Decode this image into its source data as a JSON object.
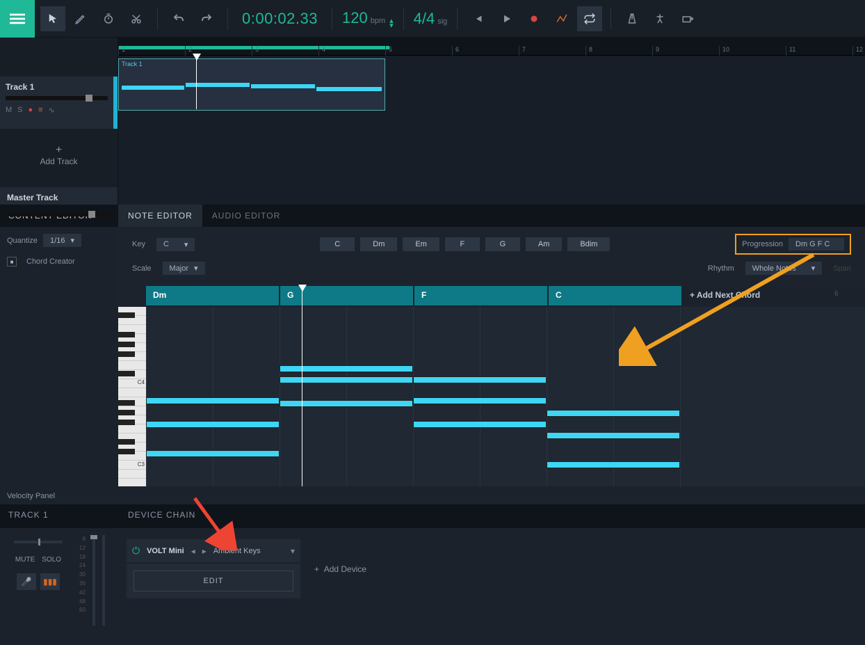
{
  "toolbar": {
    "timecode": "0:00:02.33",
    "tempo": "120",
    "tempo_unit": "bpm",
    "timesig": "4/4",
    "timesig_unit": "sig"
  },
  "track": {
    "name": "Track 1",
    "mute": "M",
    "solo": "S",
    "add": "Add Track",
    "master": "Master Track"
  },
  "content_editor": "CONTENT EDITOR",
  "editor_tabs": {
    "note": "NOTE EDITOR",
    "audio": "AUDIO EDITOR"
  },
  "quantize": {
    "label": "Quantize",
    "value": "1/16"
  },
  "chord_creator": "Chord Creator",
  "key": {
    "label": "Key",
    "value": "C"
  },
  "scale": {
    "label": "Scale",
    "value": "Major"
  },
  "chords": [
    "C",
    "Dm",
    "Em",
    "F",
    "G",
    "Am",
    "Bdim"
  ],
  "progression": {
    "label": "Progression",
    "value": "Dm G F C"
  },
  "rhythm": {
    "label": "Rhythm",
    "value": "Whole Notes"
  },
  "span": "Span",
  "chord_blocks": [
    "Dm",
    "G",
    "F",
    "C"
  ],
  "add_next_chord": "+ Add Next Chord",
  "ruler_num_6": "6",
  "piano_labels": {
    "c4": "C4",
    "c3": "C3"
  },
  "velocity": "Velocity Panel",
  "bottom_track": "TRACK 1",
  "device_chain": "DEVICE CHAIN",
  "mute": "MUTE",
  "solo": "SOLO",
  "device": {
    "name": "VOLT Mini",
    "preset": "Ambient Keys",
    "edit": "EDIT"
  },
  "add_device": "Add Device",
  "meter_marks": [
    "6",
    "12",
    "18",
    "24",
    "30",
    "36",
    "42",
    "48",
    "60"
  ],
  "ruler_marks": [
    "1",
    "2",
    "3",
    "4",
    "5",
    "6",
    "7",
    "8",
    "9",
    "10",
    "11",
    "12"
  ],
  "clip_label": "Track 1"
}
